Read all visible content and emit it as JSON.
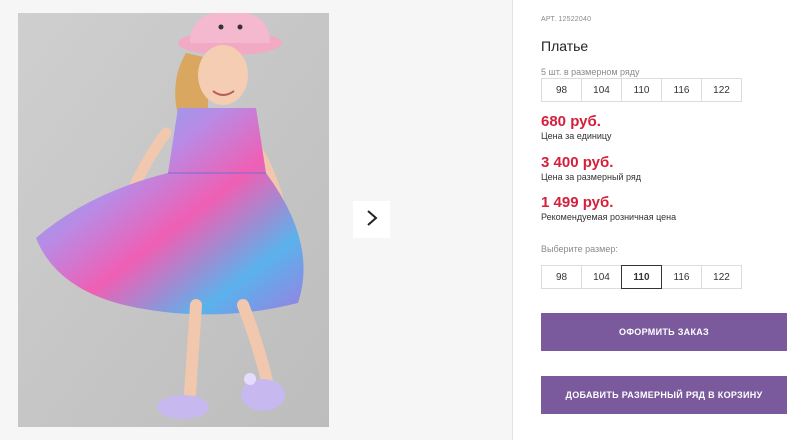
{
  "product": {
    "sku": "АРТ. 12522040",
    "title": "Платье"
  },
  "size_range": {
    "caption": "5 шт. в размерном ряду",
    "sizes": [
      "98",
      "104",
      "110",
      "116",
      "122"
    ]
  },
  "prices": [
    {
      "amount": "680 руб.",
      "note": "Цена за единицу"
    },
    {
      "amount": "3 400 руб.",
      "note": "Цена за размерный ряд"
    },
    {
      "amount": "1 499 руб.",
      "note": "Рекомендуемая розничная цена"
    }
  ],
  "size_picker": {
    "caption": "Выберите размер:",
    "sizes": [
      "98",
      "104",
      "110",
      "116",
      "122"
    ],
    "selected": "110"
  },
  "actions": {
    "order_label": "Оформить заказ",
    "add_range_label": "Добавить размерный ряд в корзину"
  },
  "colors": {
    "price": "#d4203a",
    "button": "#7a5a9c"
  },
  "icons": {
    "next": "chevron-right-icon"
  }
}
